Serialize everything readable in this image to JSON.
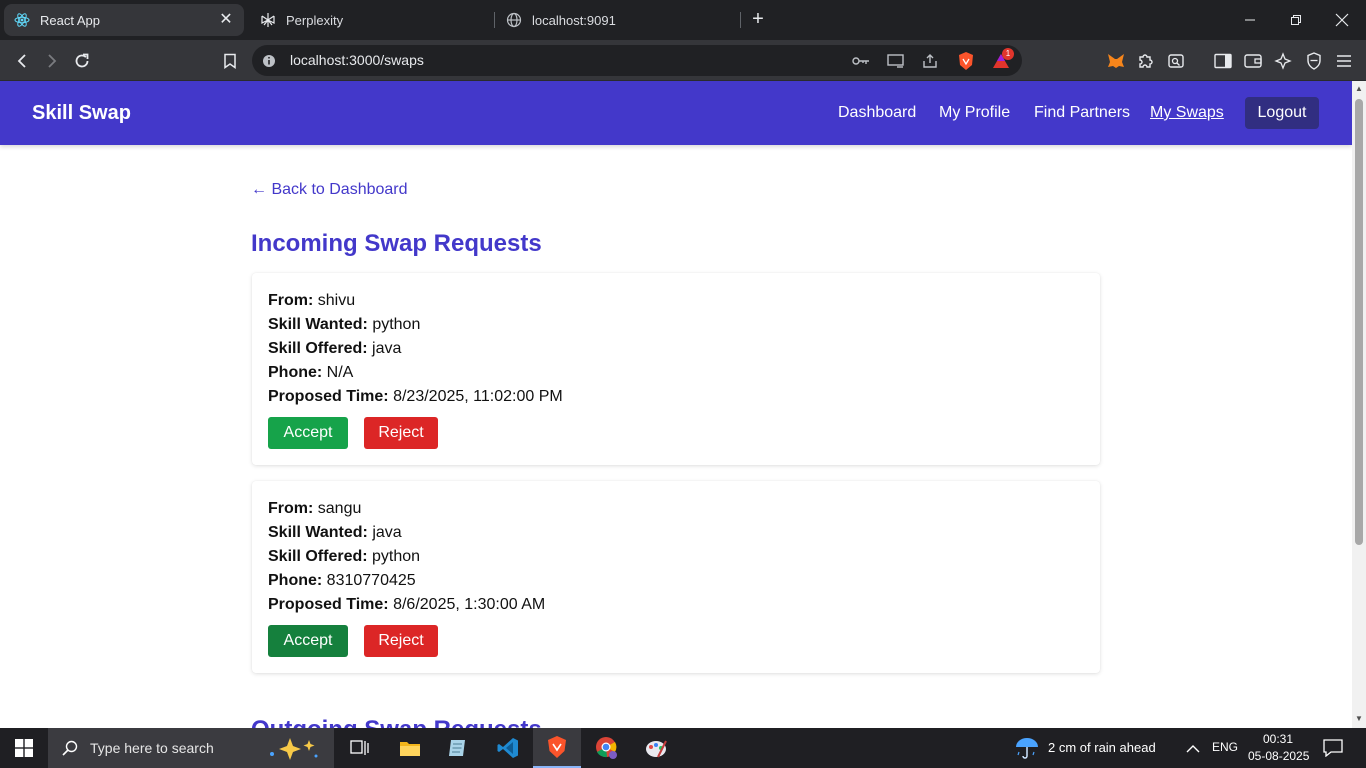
{
  "browser": {
    "tabs": [
      {
        "title": "React App",
        "active": true
      },
      {
        "title": "Perplexity",
        "active": false
      },
      {
        "title": "localhost:9091",
        "active": false
      }
    ],
    "url": "localhost:3000/swaps",
    "shields_badge": "1"
  },
  "navbar": {
    "brand": "Skill Swap",
    "links": [
      "Dashboard",
      "My Profile",
      "Find Partners",
      "My Swaps"
    ],
    "current": "My Swaps",
    "logout_label": "Logout"
  },
  "page": {
    "back_link": "← Back to Dashboard",
    "incoming_title": "Incoming Swap Requests",
    "outgoing_title": "Outgoing Swap Requests",
    "labels": {
      "from": "From:",
      "skill_wanted": "Skill Wanted:",
      "skill_offered": "Skill Offered:",
      "phone": "Phone:",
      "proposed_time": "Proposed Time:"
    },
    "requests": [
      {
        "from": "shivu",
        "skill_wanted": "python",
        "skill_offered": "java",
        "phone": "N/A",
        "proposed_time": "8/23/2025, 11:02:00 PM",
        "accept_label": "Accept",
        "reject_label": "Reject"
      },
      {
        "from": "sangu",
        "skill_wanted": "java",
        "skill_offered": "python",
        "phone": "8310770425",
        "proposed_time": "8/6/2025, 1:30:00 AM",
        "accept_label": "Accept",
        "reject_label": "Reject"
      }
    ]
  },
  "taskbar": {
    "search_placeholder": "Type here to search",
    "weather": "2 cm of rain ahead",
    "language": "ENG",
    "time": "00:31",
    "date": "05-08-2025"
  },
  "colors": {
    "navbar": "#4338ca",
    "logout": "#312e81",
    "accept": "#16a34a",
    "reject": "#dc2626"
  }
}
